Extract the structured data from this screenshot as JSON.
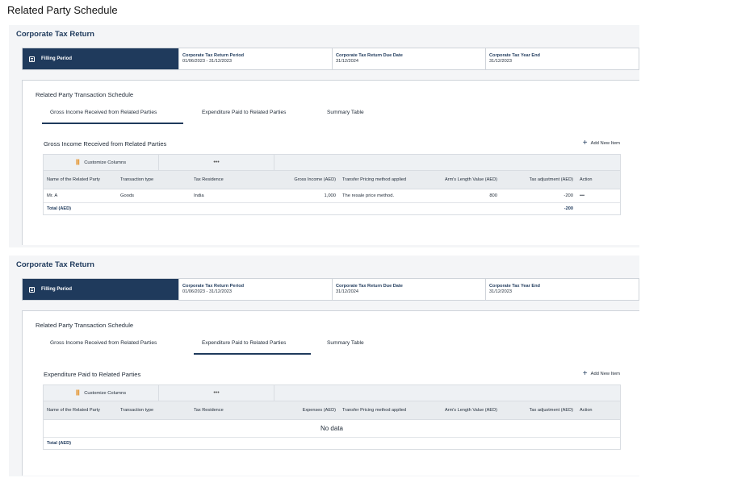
{
  "page_title": "Related Party Schedule",
  "panels": [
    {
      "header": "Corporate Tax Return",
      "filing": {
        "label": "Filling Period",
        "period_label": "Corporate Tax Return Period",
        "period_value": "01/06/2023  -  31/12/2023",
        "due_label": "Corporate Tax Return Due Date",
        "due_value": "31/12/2024",
        "year_end_label": "Corporate Tax Year End",
        "year_end_value": "31/12/2023"
      },
      "card_title": "Related Party Transaction Schedule",
      "tabs": [
        "Gross Income Received from Related Parties",
        "Expenditure Paid to Related Parties",
        "Summary Table"
      ],
      "active_tab": 0,
      "section_title": "Gross Income Received from Related Parties",
      "add_label": "Add New Item",
      "customize_label": "Customize Columns",
      "more_label": "•••",
      "columns": [
        "Name of the Related Party",
        "Transaction type",
        "Tax Residence",
        "Gross Income (AED)",
        "Transfer Pricing method applied",
        "Arm's Length Value (AED)",
        "Tax adjustment (AED)",
        "Action"
      ],
      "rows": [
        {
          "name": "Mr. A",
          "type": "Goods",
          "residence": "India",
          "amount": "1,000",
          "method": "The resale price method.",
          "arms_length": "800",
          "adjustment": "-200",
          "action": "•••"
        }
      ],
      "total_label": "Total (AED)",
      "total_value": "-200"
    },
    {
      "header": "Corporate Tax Return",
      "filing": {
        "label": "Filling Period",
        "period_label": "Corporate Tax Return Period",
        "period_value": "01/06/2023  -  31/12/2023",
        "due_label": "Corporate Tax Return Due Date",
        "due_value": "31/12/2024",
        "year_end_label": "Corporate Tax Year End",
        "year_end_value": "31/12/2023"
      },
      "card_title": "Related Party Transaction Schedule",
      "tabs": [
        "Gross Income Received from Related Parties",
        "Expenditure Paid to Related Parties",
        "Summary Table"
      ],
      "active_tab": 1,
      "section_title": "Expenditure Paid to Related Parties",
      "add_label": "Add New Item",
      "customize_label": "Customize Columns",
      "more_label": "•••",
      "columns": [
        "Name of the Related Party",
        "Transaction type",
        "Tax Residence",
        "Expenses (AED)",
        "Transfer Pricing method applied",
        "Arm's Length Value (AED)",
        "Tax adjustment (AED)",
        "Action"
      ],
      "no_data": "No data",
      "total_label": "Total (AED)",
      "total_value": ""
    }
  ],
  "colors": {
    "navy": "#1f3a5c",
    "accent_orange": "#e38b1a"
  }
}
